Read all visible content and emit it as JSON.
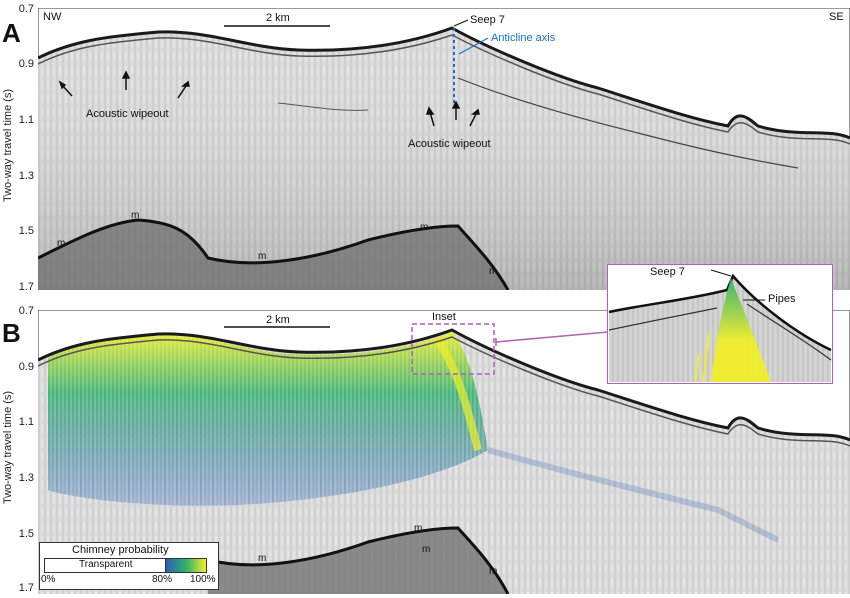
{
  "panels": [
    {
      "letter": "A",
      "corner_left": "NW",
      "corner_right": "SE",
      "scale_bar": "2 km",
      "y_ticks": [
        "0.7",
        "0.9",
        "1.1",
        "1.3",
        "1.5",
        "1.7"
      ],
      "y_axis_title": "Two-way travel time (s)",
      "labels": {
        "seep": "Seep 7",
        "anticline": "Anticline axis",
        "wipeout_left": "Acoustic wipeout",
        "wipeout_right": "Acoustic wipeout",
        "multiple": "m"
      }
    },
    {
      "letter": "B",
      "scale_bar": "2 km",
      "y_ticks": [
        "0.7",
        "0.9",
        "1.1",
        "1.3",
        "1.5",
        "1.7"
      ],
      "y_axis_title": "Two-way travel time (s)",
      "labels": {
        "inset": "Inset",
        "multiple": "m"
      },
      "inset_labels": {
        "seep": "Seep 7",
        "pipes": "Pipes"
      },
      "legend": {
        "title": "Chimney probability",
        "transparent": "Transparent",
        "min": "0%",
        "mid": "80%",
        "max": "100%"
      }
    }
  ],
  "colors": {
    "inset_frame": "#b05fb5",
    "anticline": "#1a6fc7",
    "chimney_low": "#2e5fb8",
    "chimney_mid": "#2fb06a",
    "chimney_high": "#f0ee2a"
  }
}
